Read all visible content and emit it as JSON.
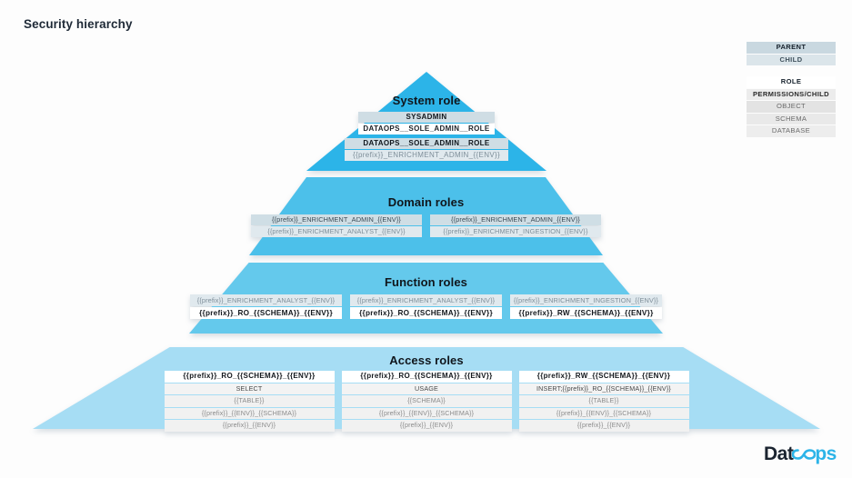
{
  "page": {
    "title": "Security hierarchy",
    "background": "#fdfdfd"
  },
  "colors": {
    "tier_system": "#2cb4e8",
    "tier_domain": "#4cc0ea",
    "tier_function": "#64c9ec",
    "tier_access": "#a6ddf4",
    "parent_row": "#cfdde4",
    "child_row": "#e0e9ee",
    "title_text": "#1f2a37",
    "logo_dark": "#1b2430",
    "logo_blue": "#2cb4e8"
  },
  "legend": {
    "block1": [
      {
        "label": "PARENT",
        "style": "parent"
      },
      {
        "label": "CHILD",
        "style": "child"
      }
    ],
    "block2": [
      {
        "label": "ROLE",
        "style": "role"
      },
      {
        "label": "PERMISSIONS/CHILD",
        "style": "permissions"
      },
      {
        "label": "OBJECT",
        "style": "object"
      },
      {
        "label": "SCHEMA",
        "style": "schema"
      },
      {
        "label": "DATABASE",
        "style": "database"
      }
    ]
  },
  "tiers": {
    "system": {
      "title": "System role",
      "cards": [
        {
          "rows": [
            "SYSADMIN",
            "DATAOPS__SOLE_ADMIN__ROLE"
          ]
        },
        {
          "rows": [
            "DATAOPS__SOLE_ADMIN__ROLE",
            "{{prefix}}_ENRICHMENT_ADMIN_{{ENV}}"
          ]
        }
      ]
    },
    "domain": {
      "title": "Domain roles",
      "cards": [
        {
          "parent": "{{prefix}}_ENRICHMENT_ADMIN_{{ENV}}",
          "child": "{{prefix}}_ENRICHMENT_ANALYST_{{ENV}}"
        },
        {
          "parent": "{{prefix}}_ENRICHMENT_ADMIN_{{ENV}}",
          "child": "{{prefix}}_ENRICHMENT_INGESTION_{{ENV}}"
        }
      ]
    },
    "function": {
      "title": "Function roles",
      "cards": [
        {
          "parent": "{{prefix}}_ENRICHMENT_ANALYST_{{ENV}}",
          "child": "{{prefix}}_RO_{{SCHEMA}}_{{ENV}}"
        },
        {
          "parent": "{{prefix}}_ENRICHMENT_ANALYST_{{ENV}}",
          "child": "{{prefix}}_RO_{{SCHEMA}}_{{ENV}}"
        },
        {
          "parent": "{{prefix}}_ENRICHMENT_INGESTION_{{ENV}}",
          "child": "{{prefix}}_RW_{{SCHEMA}}_{{ENV}}"
        }
      ]
    },
    "access": {
      "title": "Access roles",
      "cards": [
        {
          "role": "{{prefix}}_RO_{{SCHEMA}}_{{ENV}}",
          "permissions": "SELECT",
          "object": "{{TABLE}}",
          "schema": "{{prefix}}_{{ENV}}_{{SCHEMA}}",
          "database": "{{prefix}}_{{ENV}}"
        },
        {
          "role": "{{prefix}}_RO_{{SCHEMA}}_{{ENV}}",
          "permissions": "USAGE",
          "object": "{{SCHEMA}}",
          "schema": "{{prefix}}_{{ENV}}_{{SCHEMA}}",
          "database": "{{prefix}}_{{ENV}}"
        },
        {
          "role": "{{prefix}}_RW_{{SCHEMA}}_{{ENV}}",
          "permissions": "INSERT;{{prefix}}_RO_{{SCHEMA}}_{{ENV}}",
          "object": "{{TABLE}}",
          "schema": "{{prefix}}_{{ENV}}_{{SCHEMA}}",
          "database": "{{prefix}}_{{ENV}}"
        }
      ]
    }
  },
  "logo": {
    "part1": "Dat",
    "part2": "ps"
  }
}
